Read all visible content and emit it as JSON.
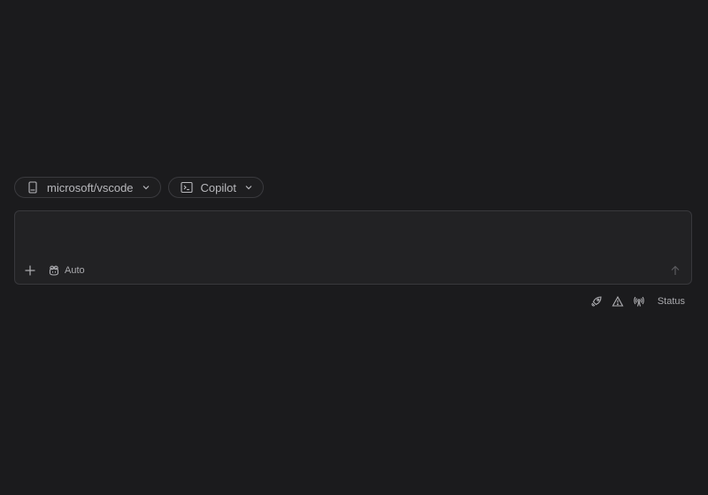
{
  "pickers": {
    "repository": {
      "label": "microsoft/vscode",
      "icon": "repo-icon"
    },
    "agent": {
      "label": "Copilot",
      "icon": "terminal-icon"
    }
  },
  "composer": {
    "value": "",
    "placeholder": "",
    "add_icon": "plus-icon",
    "mode_label": "Auto",
    "mode_icon": "copilot-icon",
    "send_icon": "arrow-up-icon"
  },
  "status_bar": {
    "icons": [
      "rocket-icon",
      "warning-icon",
      "broadcast-icon"
    ],
    "label": "Status"
  },
  "colors": {
    "background": "#1b1b1d",
    "surface": "#222224",
    "border": "#38383c",
    "text": "#b8b8bc"
  }
}
